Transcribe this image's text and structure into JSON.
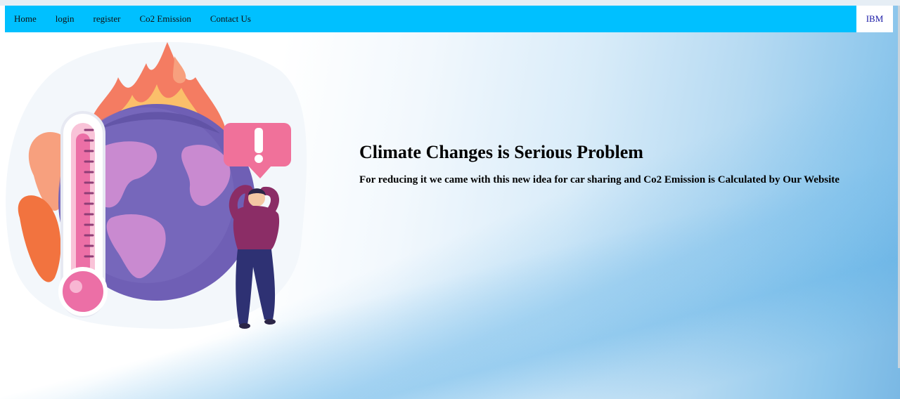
{
  "nav": {
    "items": [
      {
        "label": "Home"
      },
      {
        "label": "login"
      },
      {
        "label": "register"
      },
      {
        "label": "Co2 Emission"
      },
      {
        "label": "Contact Us"
      }
    ],
    "brand": "IBM"
  },
  "hero": {
    "title": "Climate Changes is Serious Problem",
    "subtitle": "For reducing it we came with this new idea for car sharing and Co2 Emission is Calculated by Our Website",
    "illustration": "climate-change-illustration"
  },
  "colors": {
    "navbar": "#00c0ff",
    "brand_text": "#1a1aa6",
    "globe": "#6f5fb5",
    "continents": "#c98ad0",
    "fire": "#f59a5a",
    "thermometer": "#ec6fa6"
  }
}
